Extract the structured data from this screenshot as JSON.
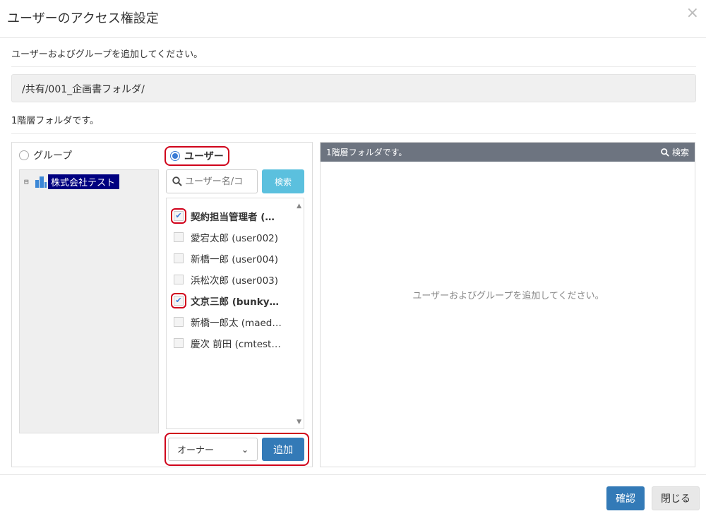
{
  "dialog": {
    "title": "ユーザーのアクセス権設定",
    "close_glyph": "×",
    "instruction": "ユーザーおよびグループを追加してください。",
    "path": "/共有/001_企画書フォルダ/",
    "level_text": "1階層フォルダです。"
  },
  "left": {
    "radio_group_label": "グループ",
    "radio_user_label": "ユーザー",
    "selected_mode": "user",
    "tree": {
      "toggle": "⊟",
      "node_label": "株式会社テスト",
      "node_icon": "building-icon"
    },
    "search": {
      "placeholder": "ユーザー名/コ",
      "button_label": "検索"
    },
    "users": [
      {
        "name": "契約担当管理者 (…",
        "checked": true
      },
      {
        "name": "愛宕太郎 (user002)",
        "checked": false
      },
      {
        "name": "新橋一郎 (user004)",
        "checked": false
      },
      {
        "name": "浜松次郎 (user003)",
        "checked": false
      },
      {
        "name": "文京三郎 (bunky…",
        "checked": true
      },
      {
        "name": "新橋一郎太 (maed…",
        "checked": false
      },
      {
        "name": "慶次 前田 (cmtest…",
        "checked": false
      }
    ],
    "role_select": {
      "value": "オーナー"
    },
    "add_button_label": "追加"
  },
  "right": {
    "header_title": "1階層フォルダです。",
    "search_label": "検索",
    "empty_message": "ユーザーおよびグループを追加してください。"
  },
  "footer": {
    "confirm_label": "確認",
    "close_label": "閉じる"
  },
  "colors": {
    "primary": "#337ab7",
    "info": "#5bc0de",
    "highlight": "#d0021b",
    "panel_header": "#6d7480",
    "tree_selection": "#000080"
  }
}
